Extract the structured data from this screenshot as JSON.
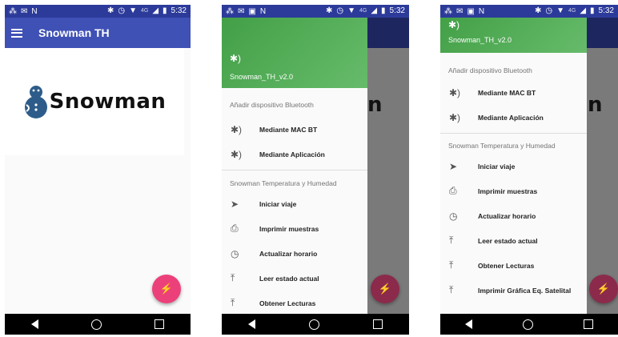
{
  "status": {
    "time": "5:32",
    "signal_tag": "4G"
  },
  "app": {
    "title": "Snowman TH",
    "logo_text": "Snowman",
    "bg_logo_fragment": "n"
  },
  "drawer": {
    "device_name": "Snowman_TH_v2.0",
    "section_bluetooth": "Añadir dispositivo Bluetooth",
    "bt_items": [
      {
        "label": "Mediante MAC BT",
        "icon": "bluetooth-icon"
      },
      {
        "label": "Mediante Aplicación",
        "icon": "bluetooth-icon"
      }
    ],
    "section_sensor": "Snowman Temperatura y Humedad",
    "sensor_items": [
      {
        "label": "Iniciar viaje",
        "icon": "send-icon"
      },
      {
        "label": "Imprimir muestras",
        "icon": "print-icon"
      },
      {
        "label": "Actualizar horario",
        "icon": "clock-icon"
      },
      {
        "label": "Leer estado actual",
        "icon": "upload-icon"
      },
      {
        "label": "Obtener Lecturas",
        "icon": "upload-icon"
      },
      {
        "label": "Imprimir Gráfica Eq. Satelital",
        "icon": "upload-icon"
      }
    ]
  },
  "colors": {
    "primary": "#3f51b5",
    "status_bar": "#2c3b9a",
    "accent": "#ec407a",
    "drawer_header": "#43a047"
  }
}
